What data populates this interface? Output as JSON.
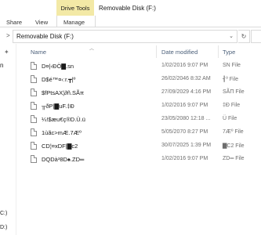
{
  "ribbon": {
    "context_group": "Drive Tools",
    "window_title": "Removable Disk (F:)",
    "tabs": [
      {
        "label": "Share"
      },
      {
        "label": "View"
      },
      {
        "label": "Manage",
        "active": true
      }
    ],
    "context_color": "#f3e9a6"
  },
  "address": {
    "back_chevron": ">",
    "path": "Removable Disk (F:)",
    "dropdown": "⌄",
    "refresh": "↻"
  },
  "nav": {
    "partial_item": "n",
    "drive_items": [
      {
        "label": "C:)"
      },
      {
        "label": "D:)"
      }
    ]
  },
  "columns": {
    "name": "Name",
    "date": "Date modified",
    "type": "Type"
  },
  "files": [
    {
      "name": "D¤|‹ÐÖ▇.sn",
      "date": "1/02/2016 9:07 PM",
      "type": "SN File"
    },
    {
      "name": "D$é™¤‹ːr.┳|º",
      "date": "26/02/2046 8:32 AM",
      "type": "┨º File"
    },
    {
      "name": "$fPtsAX¦∂ñ.SÃπ",
      "date": "27/09/2029 4:16 PM",
      "type": "SÃΠ File"
    },
    {
      "name": "╥ðP|▇uF.‡Ð",
      "date": "1/02/2016 9:07 PM",
      "type": "‡Ð File"
    },
    {
      "name": "¼!$æu€ç®D.Ù.ü",
      "date": "23/05/2080 12:18 ...",
      "type": "Ü File"
    },
    {
      "name": "1ùãc>mÆ.7Æº",
      "date": "5/05/2070 8:27 PM",
      "type": "7Æº File"
    },
    {
      "name": "CD¦¤xDF|▇c2",
      "date": "30/07/2025 1:39 PM",
      "type": "▇C2 File"
    },
    {
      "name": "DQDà³8D♠.ZD═",
      "date": "1/02/2016 9:07 PM",
      "type": "ZD═ File"
    }
  ]
}
